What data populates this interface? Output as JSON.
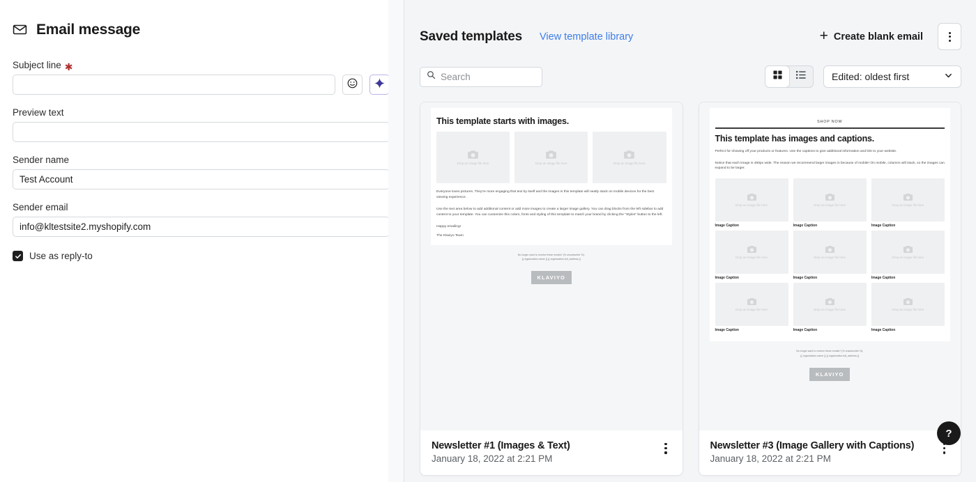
{
  "left_panel": {
    "icon": "envelope-icon",
    "title": "Email message",
    "fields": {
      "subject": {
        "label": "Subject line",
        "required_marker": "✱",
        "value": "",
        "placeholder": ""
      },
      "preview": {
        "label": "Preview text",
        "value": "",
        "placeholder": ""
      },
      "sender_name": {
        "label": "Sender name",
        "value": "Test Account",
        "placeholder": ""
      },
      "sender_email": {
        "label": "Sender email",
        "value": "info@kltestsite2.myshopify.com",
        "placeholder": ""
      }
    },
    "subject_buttons": [
      {
        "name": "emoji-icon",
        "label": "Insert emoji"
      },
      {
        "name": "ai-sparkle-icon",
        "label": "Generate with AI",
        "color": "#3f3799"
      }
    ],
    "reply_to": {
      "label": "Use as reply-to",
      "checked": true
    }
  },
  "right_panel": {
    "title": "Saved templates",
    "library_link": "View template library",
    "create_button": {
      "label": "Create blank email",
      "icon": "plus-icon"
    },
    "overflow_button": {
      "name": "kebab-menu-icon"
    },
    "search": {
      "placeholder": "Search",
      "value": "",
      "icon": "search-icon"
    },
    "view_toggle": {
      "options": [
        {
          "name": "grid-view-icon",
          "active": true
        },
        {
          "name": "list-view-icon",
          "active": false
        }
      ]
    },
    "sort": {
      "value": "Edited: oldest first",
      "icon": "chevron-down-icon"
    },
    "cards": [
      {
        "title": "Newsletter #1 (Images & Text)",
        "date": "January 18, 2022 at 2:21 PM",
        "preview": {
          "layout": "images-and-text",
          "heading": "This template starts with images.",
          "image_placeholders": 3,
          "placeholder_text": "Drop an image file here",
          "paragraphs": [
            "Everyone loves pictures. They're more engaging that text by itself and the images in this template will neatly stack on mobile devices for the best viewing experience.",
            "Use the text area below to add additional content or add more images to create a larger image gallery. You can drag blocks from the left sidebar to add content to your template. You can customize this colors, fonts and styling of this template to match your brand by clicking the \"Styles\" button to the left.",
            "Happy emailing!",
            "The Klaviyo Team"
          ],
          "footer_line_1": "No longer want to receive these emails? {% unsubscribe %}.",
          "footer_line_2": "{{ organization.name }} {{ organization.full_address }}",
          "logo": "KLAVIYO"
        }
      },
      {
        "title": "Newsletter #3 (Image Gallery with Captions)",
        "date": "January 18, 2022 at 2:21 PM",
        "preview": {
          "layout": "image-gallery-with-captions",
          "topbar": "SHOP NOW",
          "heading": "This template has images and captions.",
          "paragraphs": [
            "Perfect for showing off your products or features. Use the captions to give additional information and link to your website.",
            "Notice that each image is 450px wide. The reason we recommend larger images is because of mobile! On mobile, columns will stack, so the images can expand to be larger."
          ],
          "caption_text": "Image Caption",
          "gallery_rows": 3,
          "gallery_columns": 3,
          "placeholder_text": "Drop an image file here",
          "footer_line_1": "No longer want to receive these emails? {% unsubscribe %}.",
          "footer_line_2": "{{ organization.name }} {{ organization.full_address }}",
          "logo": "KLAVIYO"
        }
      }
    ],
    "help_button": {
      "label": "?",
      "name": "help-icon"
    }
  }
}
